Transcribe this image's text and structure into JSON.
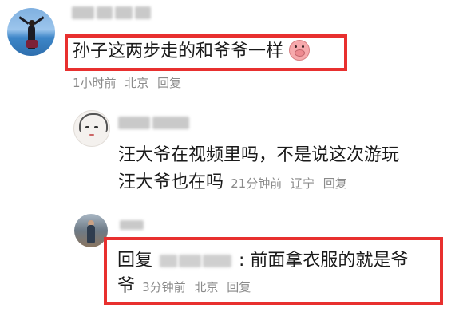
{
  "comment_1": {
    "text": "孙子这两步走的和爷爷一样",
    "emoji": "pig-face-icon",
    "time": "1小时前",
    "location": "北京",
    "reply_label": "回复"
  },
  "reply_1": {
    "line_1": "汪大爷在视频里吗，不是说这次游玩",
    "line_2": "汪大爷也在吗",
    "time": "21分钟前",
    "location": "辽宁",
    "reply_label": "回复"
  },
  "reply_2": {
    "prefix": "回复",
    "colon_text": ": 前面拿衣服的就是爷",
    "line_2": "爷",
    "time": "3分钟前",
    "location": "北京",
    "reply_label": "回复"
  },
  "colors": {
    "highlight": "#e8302f",
    "meta_text": "#8a8a8a"
  }
}
